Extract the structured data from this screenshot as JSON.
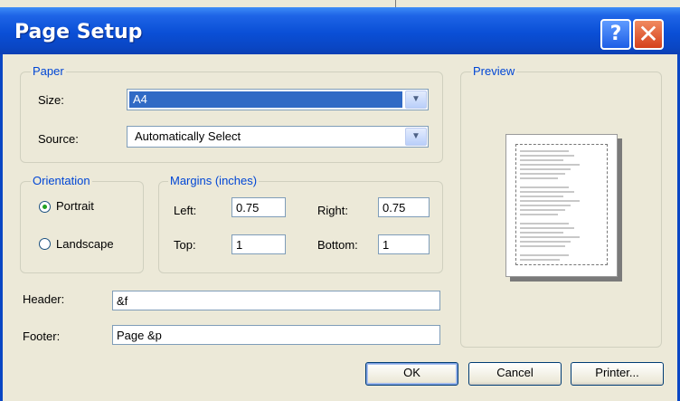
{
  "window": {
    "title": "Page Setup",
    "help_glyph": "?",
    "close_glyph": "✕"
  },
  "paper": {
    "legend": "Paper",
    "size_label": "Size:",
    "size_value": "A4",
    "source_label": "Source:",
    "source_value": "Automatically Select"
  },
  "orientation": {
    "legend": "Orientation",
    "portrait_label": "Portrait",
    "landscape_label": "Landscape",
    "selected": "Portrait"
  },
  "margins": {
    "legend": "Margins (inches)",
    "left_label": "Left:",
    "left_value": "0.75",
    "right_label": "Right:",
    "right_value": "0.75",
    "top_label": "Top:",
    "top_value": "1",
    "bottom_label": "Bottom:",
    "bottom_value": "1"
  },
  "header": {
    "label": "Header:",
    "value": "&f"
  },
  "footer": {
    "label": "Footer:",
    "value": "Page &p"
  },
  "preview": {
    "legend": "Preview"
  },
  "buttons": {
    "ok": "OK",
    "cancel": "Cancel",
    "printer": "Printer..."
  },
  "colors": {
    "title_blue": "#0a4fd6",
    "legend_blue": "#0046d5",
    "face": "#ece9d8",
    "close_red": "#d5401c"
  }
}
